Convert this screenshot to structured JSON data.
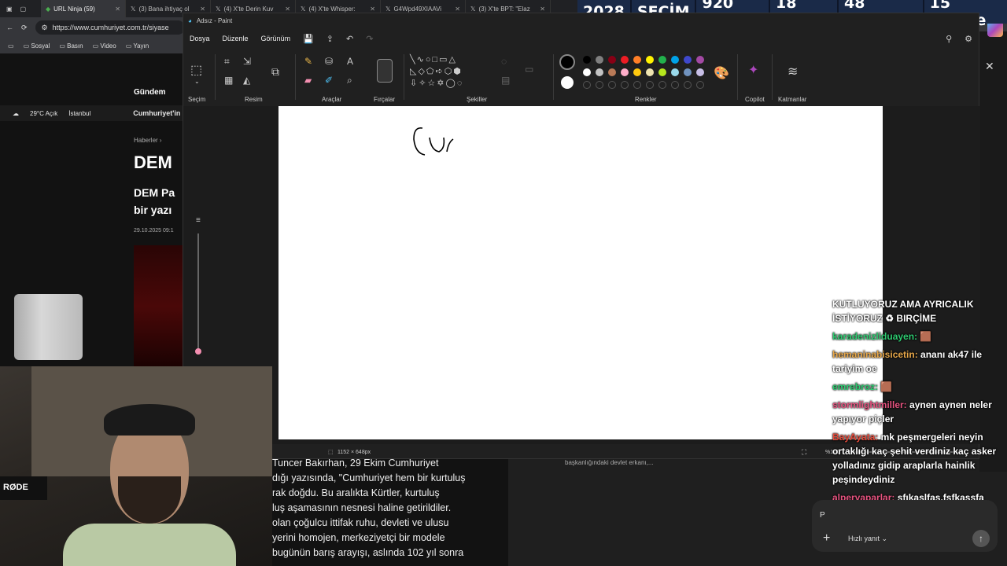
{
  "browser": {
    "tabs": [
      {
        "label": "URL Ninja (59)",
        "active": true
      },
      {
        "label": "(3) Bana ihtiyaç ol"
      },
      {
        "label": "(4) X'te Derin Kuv"
      },
      {
        "label": "(4) X'te Whisper: "
      },
      {
        "label": "G4Wpd49XIAAVi"
      },
      {
        "label": "(3) X'te BPT: \"Elaz"
      }
    ],
    "url": "https://www.cumhuriyet.com.tr/siyase",
    "bookmarks": [
      "Sosyal",
      "Basın",
      "Video",
      "Yayın"
    ]
  },
  "countdown": {
    "year_label": "2028",
    "title": "SEÇİM",
    "days": "920 Gün",
    "hours": "18 Saat",
    "minutes": "48 Dakika",
    "seconds": "15 Saniye"
  },
  "site": {
    "nav": "Gündem",
    "weather": "29°C Açık",
    "city": "İstanbul",
    "brand": "Cumhuriyet'in",
    "crumb": "Haberler",
    "headline": "DEM",
    "subhead": "DEM Pa bir yazı",
    "date": "29.10.2025 09:1",
    "article_lines": [
      "Tuncer Bakırhan, 29 Ekim Cumhuriyet",
      "dığı yazısında, \"Cumhuriyet hem bir kurtuluş",
      "rak doğdu. Bu aralıkta Kürtler, kurtuluş",
      "luş aşamasının nesnesi haline getirildiler.",
      "olan çoğulcu ittifak ruhu, devleti ve ulusu",
      "yerini homojen, merkeziyetçi bir modele",
      "bugünün barış arayışı, aslında 102 yıl sonra"
    ],
    "side_snippet": "başkanlığındaki devlet erkanı,..."
  },
  "paint": {
    "title": "Adsız - Paint",
    "menu": [
      "Dosya",
      "Düzenle",
      "Görünüm"
    ],
    "groups": {
      "selection": "Seçim",
      "image": "Resim",
      "tools": "Araçlar",
      "brushes": "Fırçalar",
      "shapes": "Şekiller",
      "colors": "Renkler",
      "copilot": "Copilot",
      "layers": "Katmanlar"
    },
    "canvas_size": "1152 × 648px",
    "zoom": "%100",
    "scribble": "Cu"
  },
  "colors": {
    "row1": [
      "#000000",
      "#7f7f7f",
      "#880015",
      "#ed1c24",
      "#ff7f27",
      "#fff200",
      "#22b14c",
      "#00a2e8",
      "#3f48cc",
      "#a349a4"
    ],
    "row2": [
      "#ffffff",
      "#c3c3c3",
      "#b97a57",
      "#ffaec9",
      "#ffc90e",
      "#efe4b0",
      "#b5e61d",
      "#99d9ea",
      "#7092be",
      "#c8bfe7"
    ]
  },
  "chat": [
    {
      "user": "",
      "text": "KUTLUYORUZ AMA AYRICALIK İSTİYORUZ ♻ BIRÇİME",
      "color": "#ffffff"
    },
    {
      "user": "karadenizliduayen:",
      "text": "🟫",
      "color": "#2ecc71"
    },
    {
      "user": "hemaninabisicetin:",
      "text": "ananı ak47 ile tariyim oe",
      "color": "#e8a84a"
    },
    {
      "user": "emrebroz:",
      "text": "🟫",
      "color": "#2ecc71"
    },
    {
      "user": "stormlightmiller:",
      "text": "aynen aynen neler yapıyor piçler",
      "color": "#e75480"
    },
    {
      "user": "BayAyata:",
      "text": "mk peşmergeleri neyin ortaklığı kaç şehit verdiniz kaç asker yolladınız gidip araplarla hainlik peşindeydiniz",
      "color": "#e74c3c"
    },
    {
      "user": "alperyaparlar:",
      "text": "sfıkaslfas,fsfkasşfa",
      "color": "#e75480"
    }
  ],
  "reply": {
    "quick_reply": "Hızlı yanıt",
    "avatar": "P"
  },
  "webcam": {
    "mic_brand": "RØDE"
  }
}
